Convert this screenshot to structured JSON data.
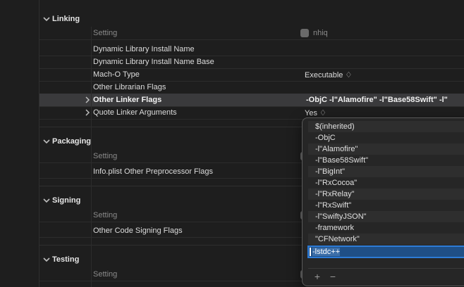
{
  "sections": {
    "linking": {
      "title": "Linking",
      "header": {
        "setting": "Setting",
        "target": "nhiq"
      },
      "rows": [
        {
          "name": "Dynamic Library Install Name",
          "value": ""
        },
        {
          "name": "Dynamic Library Install Name Base",
          "value": ""
        },
        {
          "name": "Mach-O Type",
          "value": "Executable ♢"
        },
        {
          "name": "Other Librarian Flags",
          "value": ""
        },
        {
          "name": "Other Linker Flags",
          "value": "-ObjC -l\"Alamofire\" -l\"Base58Swift\" -l\""
        },
        {
          "name": "Quote Linker Arguments",
          "value": "Yes ♢"
        }
      ]
    },
    "packaging": {
      "title": "Packaging",
      "header": {
        "setting": "Setting"
      },
      "rows": [
        {
          "name": "Info.plist Other Preprocessor Flags",
          "value": ""
        }
      ]
    },
    "signing": {
      "title": "Signing",
      "header": {
        "setting": "Setting"
      },
      "rows": [
        {
          "name": "Other Code Signing Flags",
          "value": ""
        }
      ]
    },
    "testing": {
      "title": "Testing",
      "header": {
        "setting": "Setting"
      }
    }
  },
  "popover": {
    "items": [
      "$(inherited)",
      "-ObjC",
      "-l\"Alamofire\"",
      "-l\"Base58Swift\"",
      "-l\"BigInt\"",
      "-l\"RxCocoa\"",
      "-l\"RxRelay\"",
      "-l\"RxSwift\"",
      "-l\"SwiftyJSON\"",
      "-framework",
      "\"CFNetwork\""
    ],
    "editing_value": "-lstdc++",
    "add_label": "+",
    "remove_label": "−"
  }
}
